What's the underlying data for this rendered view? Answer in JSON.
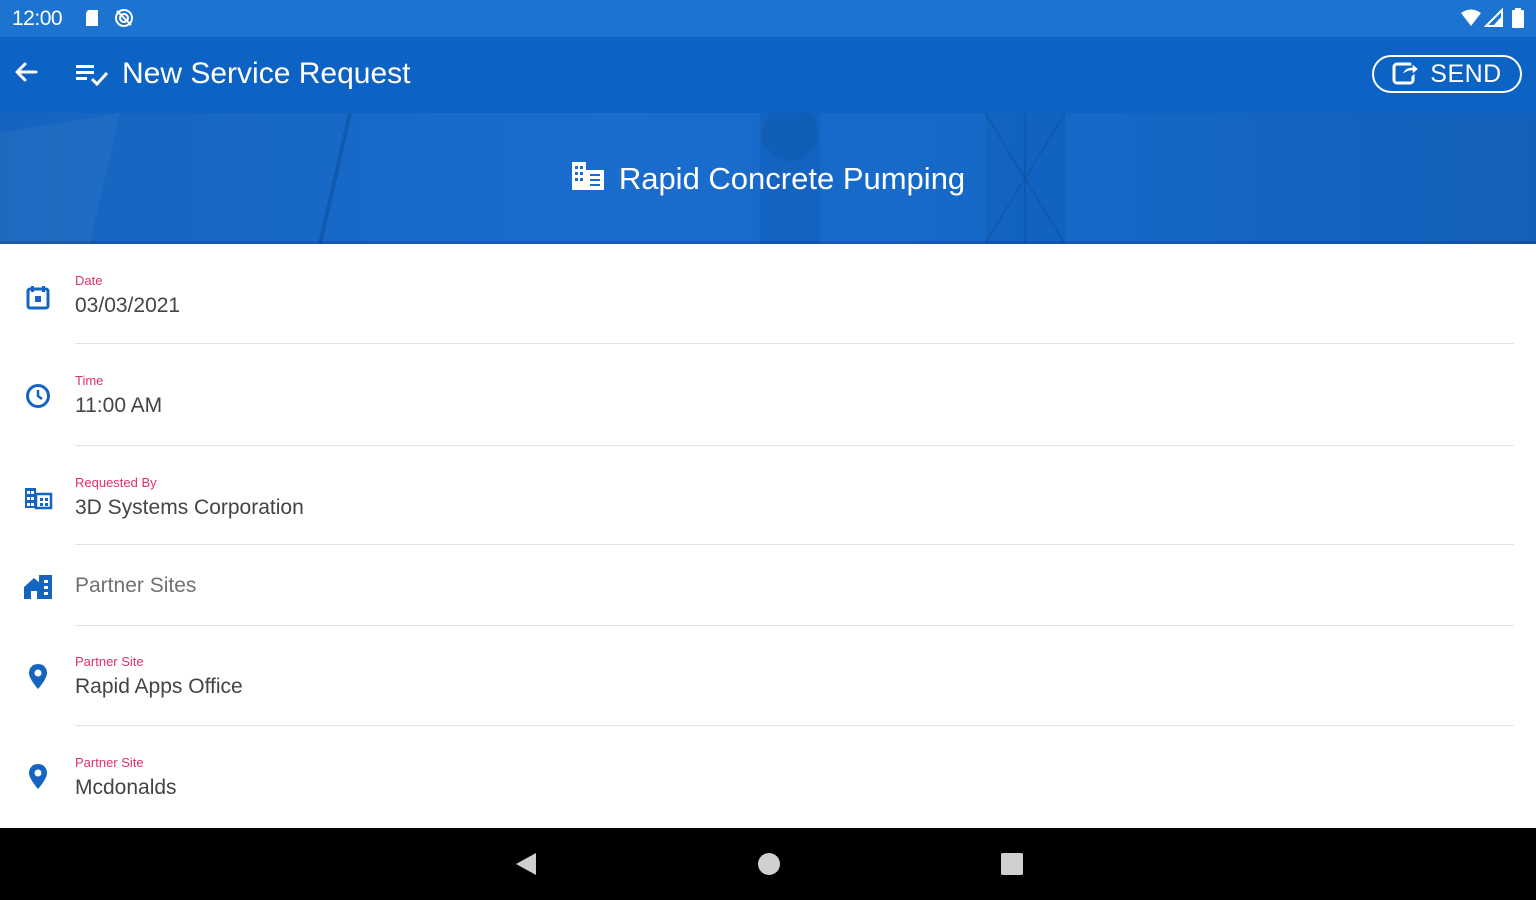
{
  "status_bar": {
    "time": "12:00",
    "icons": [
      "sd-card-icon",
      "sync-disabled-icon",
      "wifi-icon",
      "signal-icon",
      "battery-icon"
    ]
  },
  "app_bar": {
    "title": "New Service Request",
    "send_label": "SEND",
    "back_icon": "arrow-back-icon",
    "title_icon": "playlist-check-icon",
    "send_icon": "share-icon"
  },
  "hero": {
    "company": "Rapid Concrete Pumping",
    "icon": "building-icon"
  },
  "fields": {
    "date": {
      "label": "Date",
      "value": "03/03/2021",
      "icon": "calendar-icon"
    },
    "time": {
      "label": "Time",
      "value": "11:00 AM",
      "icon": "clock-icon"
    },
    "requested_by": {
      "label": "Requested By",
      "value": "3D Systems Corporation",
      "icon": "domain-icon"
    },
    "partner_sites": {
      "value": "Partner Sites",
      "icon": "home-city-icon"
    },
    "partner_site_1": {
      "label": "Partner Site",
      "value": "Rapid Apps Office",
      "icon": "map-marker-icon"
    },
    "partner_site_2": {
      "label": "Partner Site",
      "value": "Mcdonalds",
      "icon": "map-marker-icon"
    }
  },
  "nav_bar": {
    "buttons": [
      "back-triangle-icon",
      "home-circle-icon",
      "recents-square-icon"
    ]
  },
  "colors": {
    "primary": "#0d63c4",
    "status_bar": "#1c73d0",
    "accent_label": "#e0306b",
    "icon_blue": "#1565c0"
  }
}
